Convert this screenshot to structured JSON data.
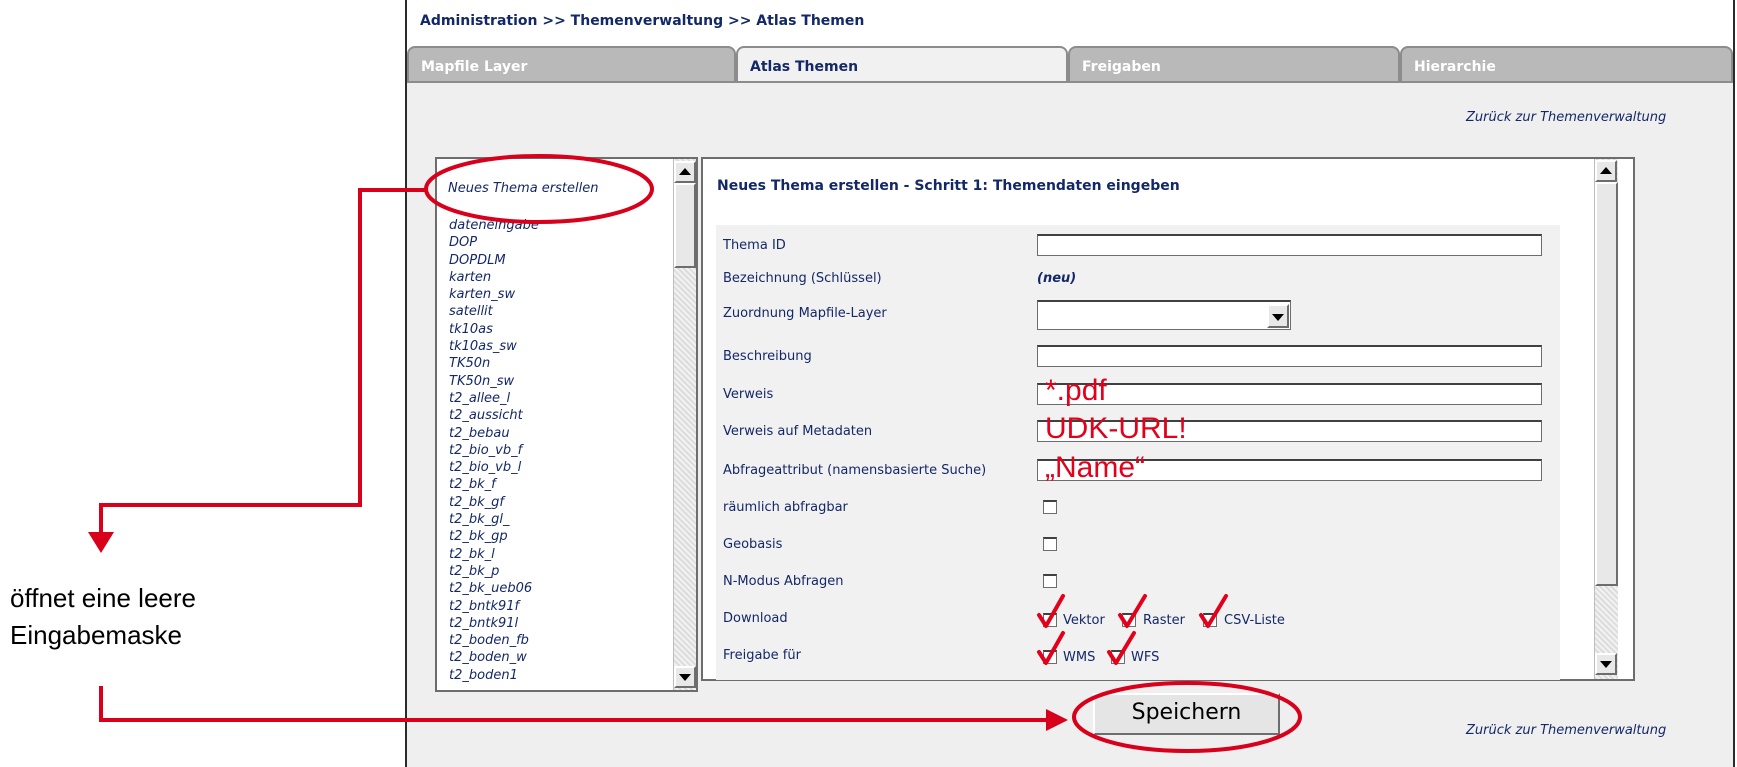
{
  "breadcrumb": "Administration >> Themenverwaltung >> Atlas Themen",
  "tabs": [
    {
      "label": "Mapfile Layer",
      "active": false
    },
    {
      "label": "Atlas Themen",
      "active": true
    },
    {
      "label": "Freigaben",
      "active": false
    },
    {
      "label": "Hierarchie",
      "active": false
    }
  ],
  "back_link": "Zurück zur Themenverwaltung",
  "theme_list": {
    "new_item": "Neues Thema erstellen",
    "items": [
      "dateneingabe",
      "DOP",
      "DOPDLM",
      "karten",
      "karten_sw",
      "satellit",
      "tk10as",
      "tk10as_sw",
      "TK50n",
      "TK50n_sw",
      "t2_allee_l",
      "t2_aussicht",
      "t2_bebau",
      "t2_bio_vb_f",
      "t2_bio_vb_l",
      "t2_bk_f",
      "t2_bk_gf",
      "t2_bk_gl_",
      "t2_bk_gp",
      "t2_bk_l",
      "t2_bk_p",
      "t2_bk_ueb06",
      "t2_bntk91f",
      "t2_bntk91l",
      "t2_boden_fb",
      "t2_boden_w",
      "t2_boden1"
    ]
  },
  "form": {
    "title": "Neues Thema erstellen - Schritt 1: Themendaten eingeben",
    "labels": {
      "thema_id": "Thema ID",
      "bezeichnung": "Bezeichnung (Schlüssel)",
      "zuordnung": "Zuordnung Mapfile-Layer",
      "beschreibung": "Beschreibung",
      "verweis": "Verweis",
      "verweis_meta": "Verweis auf Metadaten",
      "abfrageattribut": "Abfrageattribut (namensbasierte Suche)",
      "raeumlich": "räumlich abfragbar",
      "geobasis": "Geobasis",
      "nmodus": "N-Modus Abfragen",
      "download": "Download",
      "freigabe": "Freigabe für"
    },
    "bezeichnung_value": "(neu)",
    "download_options": [
      "Vektor",
      "Raster",
      "CSV-Liste"
    ],
    "freigabe_options": [
      "WMS",
      "WFS"
    ],
    "save_label": "Speichern"
  },
  "annotations": {
    "verweis": "*.pdf",
    "verweis_meta": "UDK-URL!",
    "abfrageattribut": "„Name“",
    "side_line1": "öffnet eine leere",
    "side_line2": "Eingabemaske"
  },
  "colors": {
    "annotation_red": "#e3001b",
    "text_navy": "#142868",
    "panel_gray": "#efefef"
  }
}
